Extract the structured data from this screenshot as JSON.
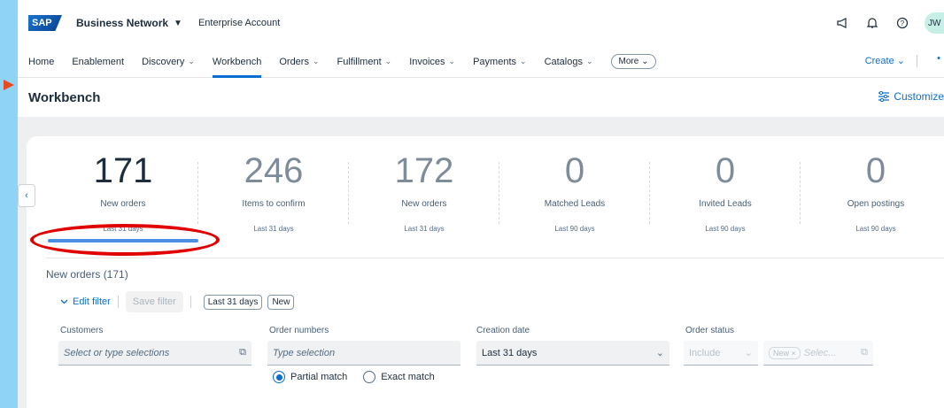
{
  "shell": {
    "logo": "SAP",
    "brand": "Business Network",
    "brand_caret": "▼",
    "account": "Enterprise Account",
    "avatar": "JW"
  },
  "nav": {
    "items": [
      {
        "label": "Home",
        "caret": ""
      },
      {
        "label": "Enablement",
        "caret": ""
      },
      {
        "label": "Discovery",
        "caret": "⌄"
      },
      {
        "label": "Workbench",
        "caret": ""
      },
      {
        "label": "Orders",
        "caret": "⌄"
      },
      {
        "label": "Fulfillment",
        "caret": "⌄"
      },
      {
        "label": "Invoices",
        "caret": "⌄"
      },
      {
        "label": "Payments",
        "caret": "⌄"
      },
      {
        "label": "Catalogs",
        "caret": "⌄"
      }
    ],
    "more": "More ⌄",
    "create": "Create ⌄",
    "overflow": "•"
  },
  "page": {
    "title": "Workbench",
    "customize": "Customize",
    "side_toggle": "‹"
  },
  "tiles": [
    {
      "value": "171",
      "label": "New orders",
      "period": "Last 31 days"
    },
    {
      "value": "246",
      "label": "Items to confirm",
      "period": "Last 31 days"
    },
    {
      "value": "172",
      "label": "New orders",
      "period": "Last 31 days"
    },
    {
      "value": "0",
      "label": "Matched Leads",
      "period": "Last 90 days"
    },
    {
      "value": "0",
      "label": "Invited Leads",
      "period": "Last 90 days"
    },
    {
      "value": "0",
      "label": "Open postings",
      "period": "Last 90 days"
    }
  ],
  "section": {
    "title": "New orders (171)"
  },
  "filters": {
    "edit": "Edit filter",
    "save": "Save filter",
    "chips": [
      "Last 31 days",
      "New"
    ],
    "customers": {
      "label": "Customers",
      "placeholder": "Select or type selections"
    },
    "order_numbers": {
      "label": "Order numbers",
      "placeholder": "Type selection"
    },
    "creation_date": {
      "label": "Creation date",
      "value": "Last 31 days"
    },
    "order_status": {
      "label": "Order status",
      "include": "Include",
      "token": "New ×",
      "placeholder": "Selec..."
    },
    "match": {
      "partial": "Partial match",
      "exact": "Exact match"
    }
  }
}
